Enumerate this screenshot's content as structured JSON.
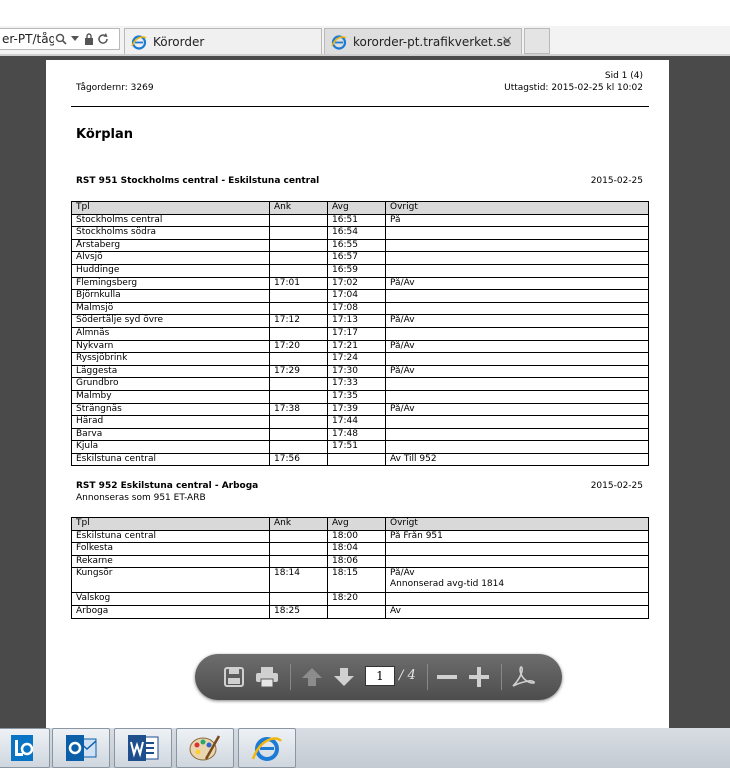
{
  "browser": {
    "address_text": "er-PT/tåg",
    "tabs": [
      {
        "label": "Körorder"
      },
      {
        "label": "kororder-pt.trafikverket.se"
      }
    ],
    "close_glyph": "×"
  },
  "document": {
    "page_info": "Sid 1 (4)",
    "order_number": "Tågordernr: 3269",
    "printed_at": "Uttagstid: 2015-02-25 kl 10:02",
    "title": "Körplan",
    "headers": {
      "station": "Tpl",
      "arr": "Ank",
      "dep": "Avg",
      "other": "Övrigt"
    },
    "sections": [
      {
        "route": "RST 951 Stockholms central - Eskilstuna central",
        "subtitle": "",
        "date": "2015-02-25",
        "rows": [
          {
            "station": "Stockholms central",
            "arr": "",
            "dep": "16:51",
            "other": "På"
          },
          {
            "station": "Stockholms södra",
            "arr": "",
            "dep": "16:54",
            "other": ""
          },
          {
            "station": "Årstaberg",
            "arr": "",
            "dep": "16:55",
            "other": ""
          },
          {
            "station": "Älvsjö",
            "arr": "",
            "dep": "16:57",
            "other": ""
          },
          {
            "station": "Huddinge",
            "arr": "",
            "dep": "16:59",
            "other": ""
          },
          {
            "station": "Flemingsberg",
            "arr": "17:01",
            "dep": "17:02",
            "other": "På/Av"
          },
          {
            "station": "Björnkulla",
            "arr": "",
            "dep": "17:04",
            "other": ""
          },
          {
            "station": "Malmsjö",
            "arr": "",
            "dep": "17:08",
            "other": ""
          },
          {
            "station": "Södertälje syd övre",
            "arr": "17:12",
            "dep": "17:13",
            "other": "På/Av"
          },
          {
            "station": "Almnäs",
            "arr": "",
            "dep": "17:17",
            "other": ""
          },
          {
            "station": "Nykvarn",
            "arr": "17:20",
            "dep": "17:21",
            "other": "På/Av"
          },
          {
            "station": "Ryssjöbrink",
            "arr": "",
            "dep": "17:24",
            "other": ""
          },
          {
            "station": "Läggesta",
            "arr": "17:29",
            "dep": "17:30",
            "other": "På/Av"
          },
          {
            "station": "Grundbro",
            "arr": "",
            "dep": "17:33",
            "other": ""
          },
          {
            "station": "Malmby",
            "arr": "",
            "dep": "17:35",
            "other": ""
          },
          {
            "station": "Strängnäs",
            "arr": "17:38",
            "dep": "17:39",
            "other": "På/Av"
          },
          {
            "station": "Härad",
            "arr": "",
            "dep": "17:44",
            "other": ""
          },
          {
            "station": "Barva",
            "arr": "",
            "dep": "17:48",
            "other": ""
          },
          {
            "station": "Kjula",
            "arr": "",
            "dep": "17:51",
            "other": ""
          },
          {
            "station": "Eskilstuna central",
            "arr": "17:56",
            "dep": "",
            "other": "Av Till 952"
          }
        ]
      },
      {
        "route": "RST 952 Eskilstuna central - Arboga",
        "subtitle": "Annonseras som 951 ET-ARB",
        "date": "2015-02-25",
        "rows": [
          {
            "station": "Eskilstuna central",
            "arr": "",
            "dep": "18:00",
            "other": "På Från 951"
          },
          {
            "station": "Folkesta",
            "arr": "",
            "dep": "18:04",
            "other": ""
          },
          {
            "station": "Rekarne",
            "arr": "",
            "dep": "18:06",
            "other": ""
          },
          {
            "station": "Kungsör",
            "arr": "18:14",
            "dep": "18:15",
            "other": "På/Av",
            "other2": "Annonserad avg-tid 1814"
          },
          {
            "station": "Valskog",
            "arr": "",
            "dep": "18:20",
            "other": ""
          },
          {
            "station": "Arboga",
            "arr": "18:25",
            "dep": "",
            "other": "Av"
          }
        ]
      }
    ]
  },
  "pdf_toolbar": {
    "current_page": "1",
    "total_pages": "/ 4"
  },
  "taskbar": {
    "apps": [
      "lync-icon",
      "outlook-icon",
      "word-icon",
      "paint-icon",
      "internet-explorer-icon"
    ]
  }
}
